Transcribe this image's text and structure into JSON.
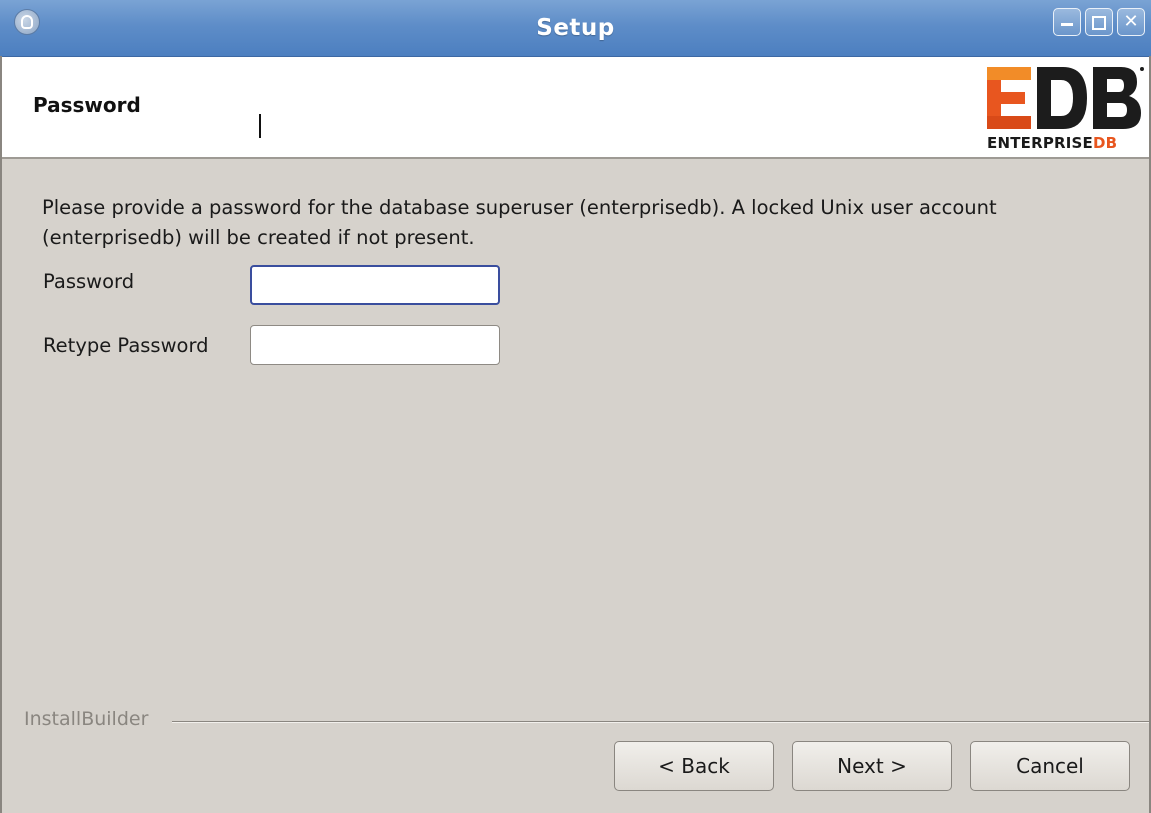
{
  "window": {
    "title": "Setup",
    "controls": {
      "minimize_icon": "minimize-icon",
      "maximize_icon": "maximize-icon",
      "close_icon": "close-icon"
    }
  },
  "header": {
    "page_title": "Password",
    "logo": {
      "mark": "EDB",
      "text_main": "ENTERPRISE",
      "text_accent": "DB",
      "accent_color": "#e8561f"
    }
  },
  "content": {
    "description": "Please provide a password for the database superuser (enterprisedb). A locked Unix user account (enterprisedb) will be created if not present.",
    "fields": [
      {
        "label": "Password",
        "value": ""
      },
      {
        "label": "Retype Password",
        "value": ""
      }
    ]
  },
  "footer": {
    "brand": "InstallBuilder",
    "back_label": "< Back",
    "next_label": "Next >",
    "cancel_label": "Cancel"
  }
}
